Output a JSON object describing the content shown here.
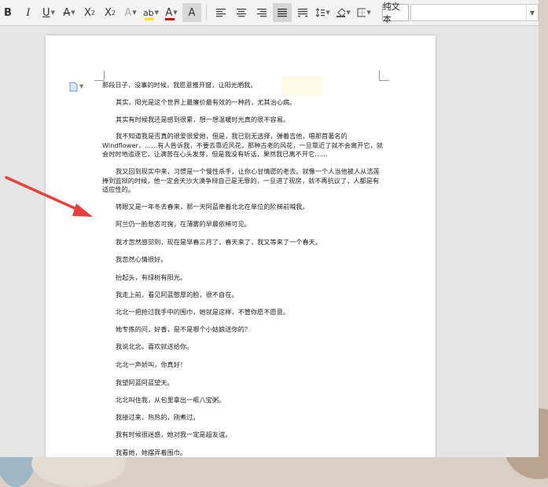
{
  "toolbar": {
    "style_current": "纯文本",
    "buttons": [
      {
        "name": "bold-button",
        "glyph": "B"
      },
      {
        "name": "italic-button",
        "glyph": "I"
      },
      {
        "name": "underline-button",
        "glyph": "U"
      },
      {
        "name": "strikethrough-button",
        "glyph": "A"
      },
      {
        "name": "superscript-button",
        "glyph": "X²"
      },
      {
        "name": "subscript-button",
        "glyph": "X₂"
      },
      {
        "name": "text-effect-button",
        "glyph": "A"
      },
      {
        "name": "highlight-button",
        "glyph": "ab"
      },
      {
        "name": "font-color-button",
        "glyph": "A"
      },
      {
        "name": "char-shading-button",
        "glyph": "A"
      }
    ],
    "colors": {
      "underline": "#1f5fc8",
      "highlight": "#ffe800",
      "font_color": "#d40000"
    }
  },
  "document": {
    "paragraphs": [
      "那段日子，没事的时候，我愿意推开窗，让阳光晒我。",
      "其实，阳光是这个世界上最廉价最有效的一种药，尤其治心病。",
      "其实有时候我还是感到很累，想一想温暖时光真的很不容易。",
      "我不知道我是否真的很爱很爱她，但是，我已别无选择，弹着吉他，唱那首著名的Windflower，……有人告诉我，不要去靠近风花，那种古老的风花，一旦靠近了就不会离开它，就会时时地追逐它，让满苦在心头发芽，但是我没有听话，果然我已离不开它……",
      "我又回到现实中来，习惯是一个慢性杀手，让你心甘情愿的老去。就像一个人当他被人从洁莲捧到监狱的时候，他一定会天沙大漠争辩自己是无罪的，一旦进了现房，就不再抗议了，人都是有适应性的。",
      "转眼又是一年冬去春来，那一天阿蓝牵着北北在单位的阶梯前喊我。",
      "阿兰仍一脸愁态可掬，在薄雾的早晨依稀可见。",
      "我才忽然感觉到，现在是早春三月了，春天来了，我又等来了一个春天。",
      "我忽然心情很好。",
      "抬起头，有绿树有阳光。",
      "我走上前，看见阿蓝憨厚的脸，很不自在。",
      "北北一把抢过我手中的围巾，她就是这样，不管你愿不愿意。",
      "她专拣的问，好香，是不是哪个小姑娘送你的？",
      "我说北北，喜欢就送给你。",
      "北北一声娇叫，你真好！",
      "我望阿蓝阿蓝望天。",
      "北北叫住我，从包里拿出一瓶八宝粥。",
      "我接过来，热热的，刚煮过。",
      "我有时候很迷惑，她对我一定是超友谊。",
      "我看她，她摆弄着围巾。"
    ]
  },
  "annotation": {
    "arrow_color": "#e8403a"
  }
}
